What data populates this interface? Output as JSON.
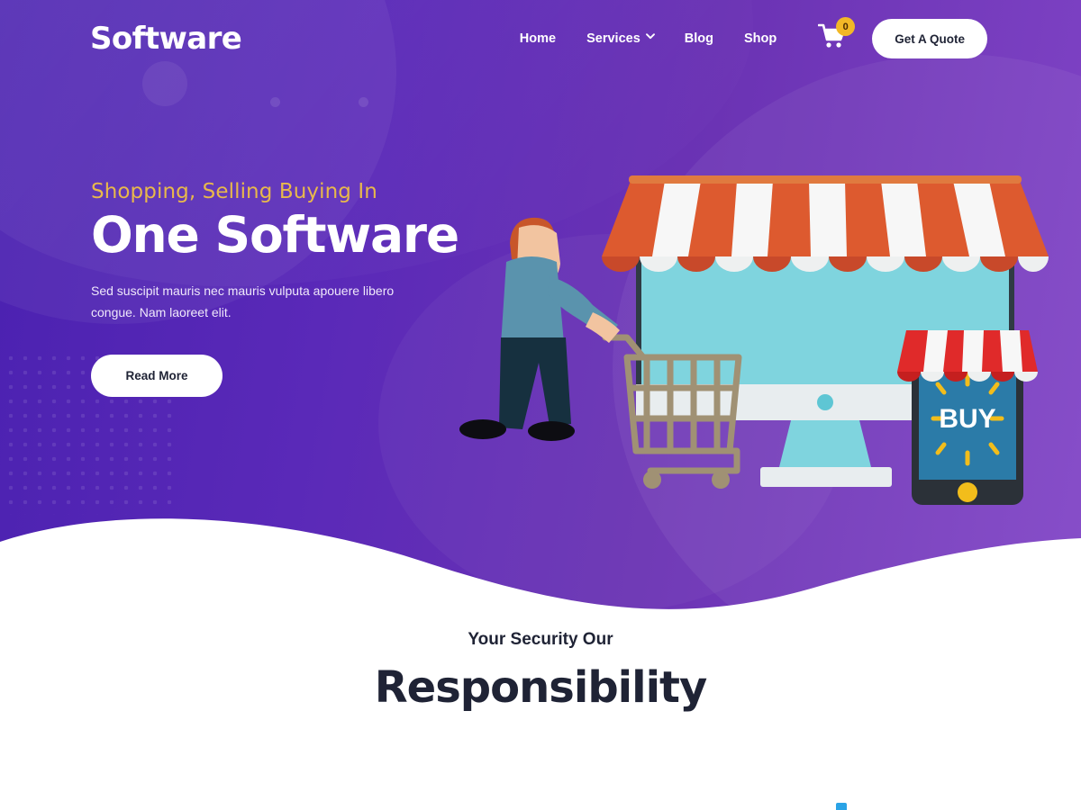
{
  "brand": {
    "logo_text": "Software"
  },
  "nav": {
    "links": [
      {
        "label": "Home",
        "has_dropdown": false,
        "icon": ""
      },
      {
        "label": "Services",
        "has_dropdown": true,
        "icon": "chevron-down-icon"
      },
      {
        "label": "Blog",
        "has_dropdown": false,
        "icon": ""
      },
      {
        "label": "Shop",
        "has_dropdown": false,
        "icon": ""
      }
    ],
    "cart": {
      "icon": "shopping-cart-icon",
      "badge_count": "0"
    },
    "cta": {
      "label": "Get A Quote"
    }
  },
  "hero": {
    "eyebrow": "Shopping, Selling Buying In",
    "title": "One Software",
    "paragraph": "Sed suscipit mauris nec mauris vulputa apouere libero congue. Nam laoreet elit.",
    "button": {
      "label": "Read More"
    },
    "illustration": {
      "name": "ecommerce-shop-illustration",
      "phone_screen_label": "BUY",
      "parts": [
        "shopper-person-icon",
        "shopping-cart-icon",
        "desktop-monitor-shop-icon",
        "mobile-phone-buy-icon",
        "shop-awning-icon"
      ]
    }
  },
  "security_section": {
    "subtitle": "Your Security Our",
    "title": "Responsibility"
  },
  "colors": {
    "purple_dark": "#4a21b0",
    "purple_mid": "#6b33b4",
    "purple_light": "#8044c6",
    "gold": "#e8b84b",
    "badge_gold": "#f2b827",
    "white": "#ffffff",
    "ink": "#1f2335",
    "awning_orange": "#dd5a2f",
    "awning_red": "#e02a2a",
    "screen_teal": "#7fd4de",
    "phone_blue": "#2b7ba8",
    "shirt_blue": "#5a93ad",
    "pants_navy": "#16303f",
    "hair_orange": "#c8562a",
    "skin": "#f2c4a0",
    "cart_tan": "#a09174"
  }
}
